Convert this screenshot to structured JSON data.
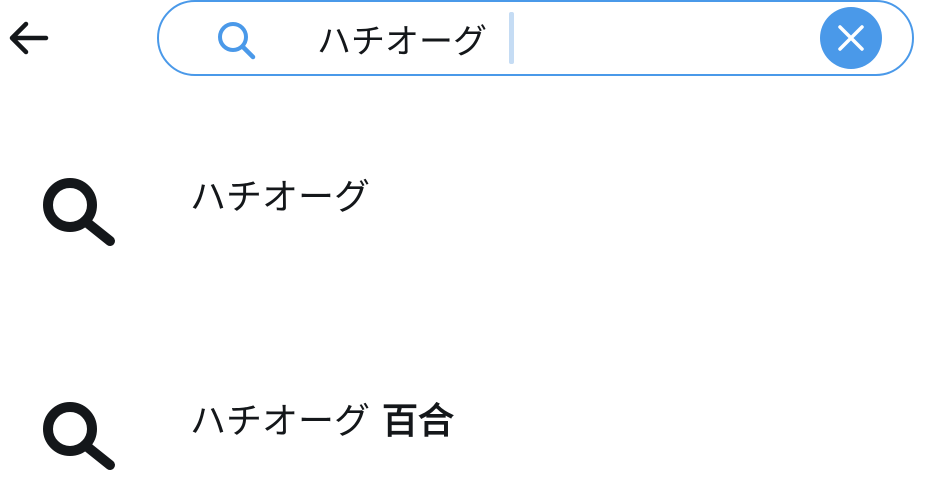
{
  "header": {
    "back_icon": "arrow-left-icon",
    "search": {
      "icon": "search-icon",
      "value": "ハチオーグ",
      "clear_icon": "close-icon"
    }
  },
  "suggestions": [
    {
      "icon": "search-icon",
      "text": "ハチオーグ",
      "bold_suffix": ""
    },
    {
      "icon": "search-icon",
      "text": "ハチオーグ",
      "bold_suffix": "百合"
    }
  ],
  "colors": {
    "accent": "#4a99e9",
    "text": "#14171a",
    "caret": "#c5dcf4"
  }
}
